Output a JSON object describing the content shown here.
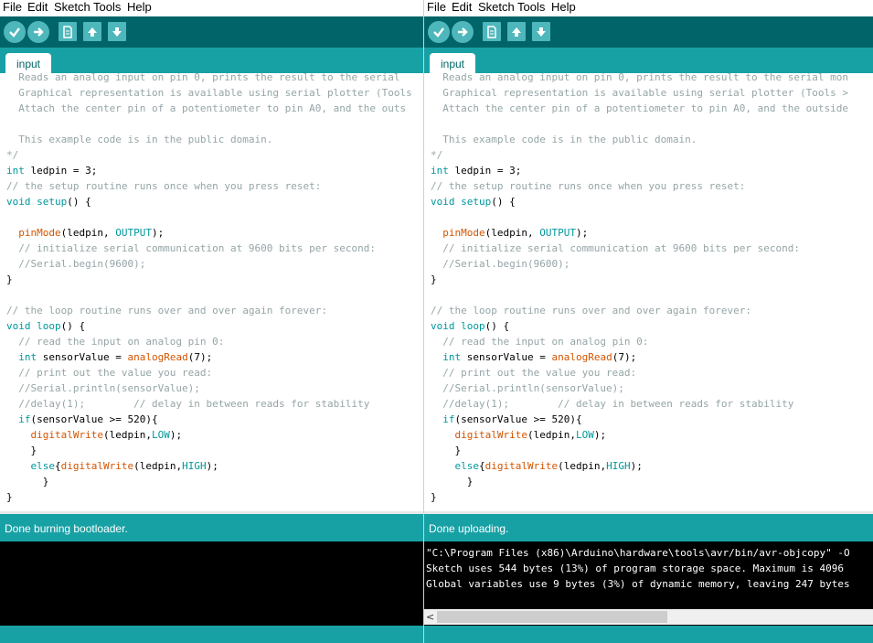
{
  "colors": {
    "toolbar_bg": "#006468",
    "tabstrip_bg": "#17a1a5",
    "button_bg": "#4db7bb",
    "comment": "#95a5a6",
    "keyword": "#00979d",
    "function": "#d35400"
  },
  "toolbar_icons": [
    "verify-icon",
    "upload-icon",
    "new-icon",
    "open-icon",
    "save-icon"
  ],
  "left": {
    "menu": [
      "File",
      "Edit",
      "Sketch",
      "Tools",
      "Help"
    ],
    "tab_label": "input",
    "status": "Done burning bootloader.",
    "console_lines": [],
    "code_lines": [
      [
        {
          "t": "  Reads an analog input on pin 0, prints the result to the serial",
          "c": "comment"
        }
      ],
      [
        {
          "t": "  Graphical representation is available using serial plotter (Tools",
          "c": "comment"
        }
      ],
      [
        {
          "t": "  Attach the center pin of a potentiometer to pin A0, and the outs",
          "c": "comment"
        }
      ],
      [],
      [
        {
          "t": "  This example code is in the public domain.",
          "c": "comment"
        }
      ],
      [
        {
          "t": "*/",
          "c": "comment"
        }
      ],
      [
        {
          "t": "int",
          "c": "type"
        },
        {
          "t": " ledpin = 3;"
        }
      ],
      [
        {
          "t": "// the setup routine runs once when you press reset:",
          "c": "comment"
        }
      ],
      [
        {
          "t": "void",
          "c": "type"
        },
        {
          "t": " "
        },
        {
          "t": "setup",
          "c": "kw"
        },
        {
          "t": "() {"
        }
      ],
      [],
      [
        {
          "t": "  "
        },
        {
          "t": "pinMode",
          "c": "fn"
        },
        {
          "t": "(ledpin, "
        },
        {
          "t": "OUTPUT",
          "c": "cons"
        },
        {
          "t": ");"
        }
      ],
      [
        {
          "t": "  // initialize serial communication at 9600 bits per second:",
          "c": "comment"
        }
      ],
      [
        {
          "t": "  //Serial.begin(9600);",
          "c": "comment"
        }
      ],
      [
        {
          "t": "}"
        }
      ],
      [],
      [
        {
          "t": "// the loop routine runs over and over again forever:",
          "c": "comment"
        }
      ],
      [
        {
          "t": "void",
          "c": "type"
        },
        {
          "t": " "
        },
        {
          "t": "loop",
          "c": "kw"
        },
        {
          "t": "() {"
        }
      ],
      [
        {
          "t": "  // read the input on analog pin 0:",
          "c": "comment"
        }
      ],
      [
        {
          "t": "  "
        },
        {
          "t": "int",
          "c": "type"
        },
        {
          "t": " sensorValue = "
        },
        {
          "t": "analogRead",
          "c": "fn"
        },
        {
          "t": "(7);"
        }
      ],
      [
        {
          "t": "  // print out the value you read:",
          "c": "comment"
        }
      ],
      [
        {
          "t": "  //Serial.println(sensorValue);",
          "c": "comment"
        }
      ],
      [
        {
          "t": "  //delay(1);        // delay in between reads for stability",
          "c": "comment"
        }
      ],
      [
        {
          "t": "  "
        },
        {
          "t": "if",
          "c": "kw"
        },
        {
          "t": "(sensorValue >= 520){"
        }
      ],
      [
        {
          "t": "    "
        },
        {
          "t": "digitalWrite",
          "c": "fn"
        },
        {
          "t": "(ledpin,"
        },
        {
          "t": "LOW",
          "c": "cons"
        },
        {
          "t": ");"
        }
      ],
      [
        {
          "t": "    }"
        }
      ],
      [
        {
          "t": "    "
        },
        {
          "t": "else",
          "c": "kw"
        },
        {
          "t": "{"
        },
        {
          "t": "digitalWrite",
          "c": "fn"
        },
        {
          "t": "(ledpin,"
        },
        {
          "t": "HIGH",
          "c": "cons"
        },
        {
          "t": ");"
        }
      ],
      [
        {
          "t": "      }"
        }
      ],
      [
        {
          "t": "}"
        }
      ]
    ]
  },
  "right": {
    "menu": [
      "File",
      "Edit",
      "Sketch",
      "Tools",
      "Help"
    ],
    "tab_label": "input",
    "status": "Done uploading.",
    "console_lines": [
      "\"C:\\Program Files (x86)\\Arduino\\hardware\\tools\\avr/bin/avr-objcopy\" -O",
      "Sketch uses 544 bytes (13%) of program storage space. Maximum is 4096",
      "Global variables use 9 bytes (3%) of dynamic memory, leaving 247 bytes"
    ],
    "code_lines": [
      [
        {
          "t": "  Reads an analog input on pin 0, prints the result to the serial mon",
          "c": "comment"
        }
      ],
      [
        {
          "t": "  Graphical representation is available using serial plotter (Tools >",
          "c": "comment"
        }
      ],
      [
        {
          "t": "  Attach the center pin of a potentiometer to pin A0, and the outside",
          "c": "comment"
        }
      ],
      [],
      [
        {
          "t": "  This example code is in the public domain.",
          "c": "comment"
        }
      ],
      [
        {
          "t": "*/",
          "c": "comment"
        }
      ],
      [
        {
          "t": "int",
          "c": "type"
        },
        {
          "t": " ledpin = 3;"
        }
      ],
      [
        {
          "t": "// the setup routine runs once when you press reset:",
          "c": "comment"
        }
      ],
      [
        {
          "t": "void",
          "c": "type"
        },
        {
          "t": " "
        },
        {
          "t": "setup",
          "c": "kw"
        },
        {
          "t": "() {"
        }
      ],
      [],
      [
        {
          "t": "  "
        },
        {
          "t": "pinMode",
          "c": "fn"
        },
        {
          "t": "(ledpin, "
        },
        {
          "t": "OUTPUT",
          "c": "cons"
        },
        {
          "t": ");"
        }
      ],
      [
        {
          "t": "  // initialize serial communication at 9600 bits per second:",
          "c": "comment"
        }
      ],
      [
        {
          "t": "  //Serial.begin(9600);",
          "c": "comment"
        }
      ],
      [
        {
          "t": "}"
        }
      ],
      [],
      [
        {
          "t": "// the loop routine runs over and over again forever:",
          "c": "comment"
        }
      ],
      [
        {
          "t": "void",
          "c": "type"
        },
        {
          "t": " "
        },
        {
          "t": "loop",
          "c": "kw"
        },
        {
          "t": "() {"
        }
      ],
      [
        {
          "t": "  // read the input on analog pin 0:",
          "c": "comment"
        }
      ],
      [
        {
          "t": "  "
        },
        {
          "t": "int",
          "c": "type"
        },
        {
          "t": " sensorValue = "
        },
        {
          "t": "analogRead",
          "c": "fn"
        },
        {
          "t": "(7);"
        }
      ],
      [
        {
          "t": "  // print out the value you read:",
          "c": "comment"
        }
      ],
      [
        {
          "t": "  //Serial.println(sensorValue);",
          "c": "comment"
        }
      ],
      [
        {
          "t": "  //delay(1);        // delay in between reads for stability",
          "c": "comment"
        }
      ],
      [
        {
          "t": "  "
        },
        {
          "t": "if",
          "c": "kw"
        },
        {
          "t": "(sensorValue >= 520){"
        }
      ],
      [
        {
          "t": "    "
        },
        {
          "t": "digitalWrite",
          "c": "fn"
        },
        {
          "t": "(ledpin,"
        },
        {
          "t": "LOW",
          "c": "cons"
        },
        {
          "t": ");"
        }
      ],
      [
        {
          "t": "    }"
        }
      ],
      [
        {
          "t": "    "
        },
        {
          "t": "else",
          "c": "kw"
        },
        {
          "t": "{"
        },
        {
          "t": "digitalWrite",
          "c": "fn"
        },
        {
          "t": "(ledpin,"
        },
        {
          "t": "HIGH",
          "c": "cons"
        },
        {
          "t": ");"
        }
      ],
      [
        {
          "t": "      }"
        }
      ],
      [
        {
          "t": "}"
        }
      ]
    ]
  }
}
